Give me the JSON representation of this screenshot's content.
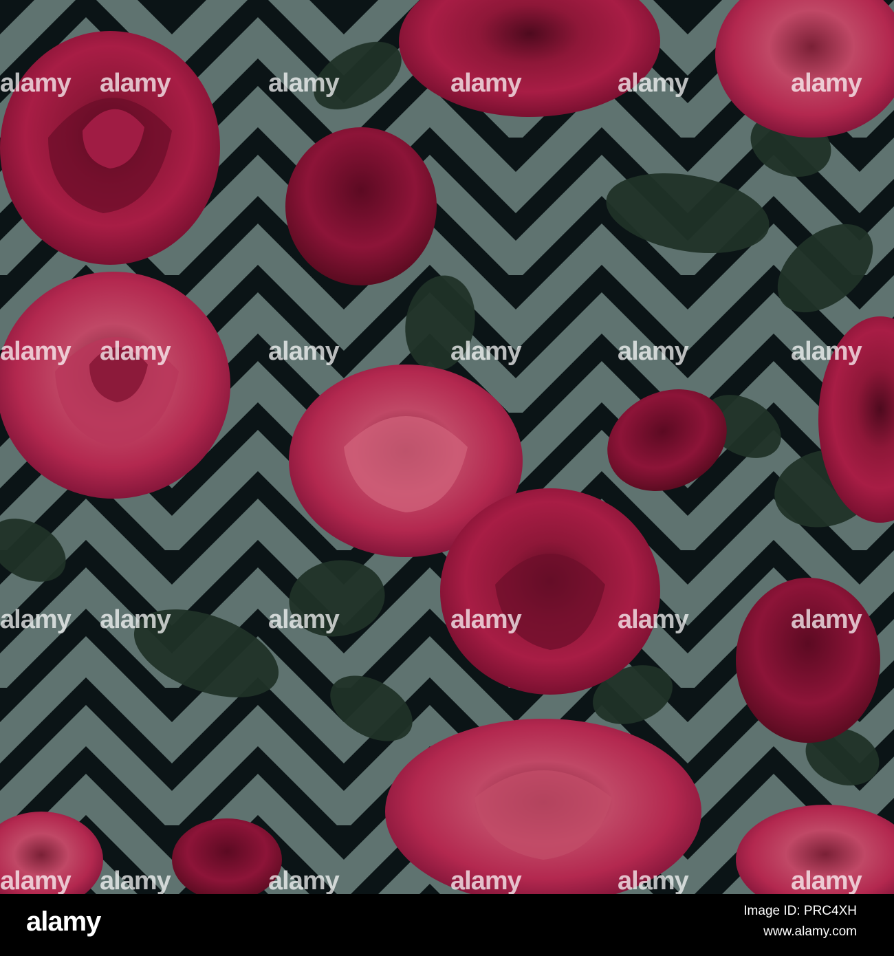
{
  "watermark": {
    "word": "alamy"
  },
  "footer": {
    "logo_text": "alamy",
    "image_id": "Image ID: PRC4XH",
    "site": "www.alamy.com"
  },
  "colors": {
    "stripe_light": "#5f7370",
    "stripe_dark": "#0b1416",
    "leaf": "#203227",
    "rose_deep": "#7c1131",
    "rose_mid": "#a3183f",
    "rose_light": "#c9516d",
    "footer_bg": "#000000"
  }
}
